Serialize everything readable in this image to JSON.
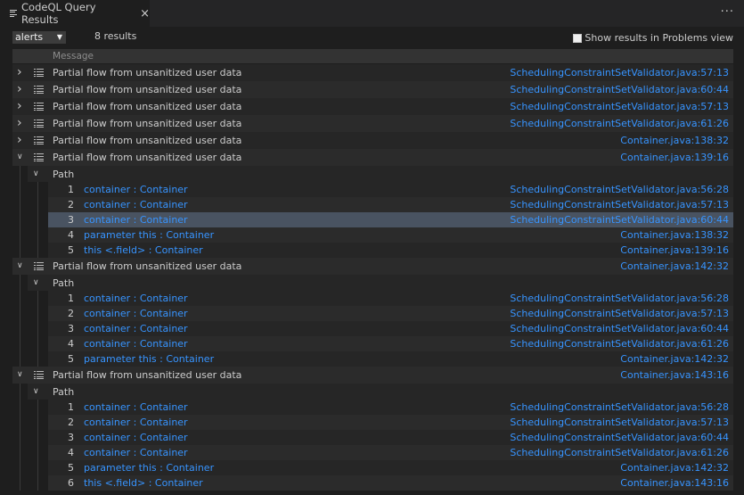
{
  "tab": {
    "title": "CodeQL Query Results",
    "close": "×",
    "icon": "list-icon"
  },
  "more": "···",
  "toolbar": {
    "select_value": "alerts",
    "count": "8 results",
    "problems_label": "Show results in Problems view"
  },
  "header": {
    "message": "Message"
  },
  "results": [
    {
      "message": "Partial flow from unsanitized user data",
      "location": "SchedulingConstraintSetValidator.java:57:13",
      "expanded": false
    },
    {
      "message": "Partial flow from unsanitized user data",
      "location": "SchedulingConstraintSetValidator.java:60:44",
      "expanded": false
    },
    {
      "message": "Partial flow from unsanitized user data",
      "location": "SchedulingConstraintSetValidator.java:57:13",
      "expanded": false
    },
    {
      "message": "Partial flow from unsanitized user data",
      "location": "SchedulingConstraintSetValidator.java:61:26",
      "expanded": false
    },
    {
      "message": "Partial flow from unsanitized user data",
      "location": "Container.java:138:32",
      "expanded": false
    },
    {
      "message": "Partial flow from unsanitized user data",
      "location": "Container.java:139:16",
      "expanded": true,
      "path_label": "Path",
      "steps": [
        {
          "num": "1",
          "text": "container : Container",
          "location": "SchedulingConstraintSetValidator.java:56:28"
        },
        {
          "num": "2",
          "text": "container : Container",
          "location": "SchedulingConstraintSetValidator.java:57:13"
        },
        {
          "num": "3",
          "text": "container : Container",
          "location": "SchedulingConstraintSetValidator.java:60:44",
          "selected": true
        },
        {
          "num": "4",
          "text": "parameter this : Container",
          "location": "Container.java:138:32"
        },
        {
          "num": "5",
          "text": "this <.field> : Container",
          "location": "Container.java:139:16"
        }
      ]
    },
    {
      "message": "Partial flow from unsanitized user data",
      "location": "Container.java:142:32",
      "expanded": true,
      "path_label": "Path",
      "steps": [
        {
          "num": "1",
          "text": "container : Container",
          "location": "SchedulingConstraintSetValidator.java:56:28"
        },
        {
          "num": "2",
          "text": "container : Container",
          "location": "SchedulingConstraintSetValidator.java:57:13"
        },
        {
          "num": "3",
          "text": "container : Container",
          "location": "SchedulingConstraintSetValidator.java:60:44"
        },
        {
          "num": "4",
          "text": "container : Container",
          "location": "SchedulingConstraintSetValidator.java:61:26"
        },
        {
          "num": "5",
          "text": "parameter this : Container",
          "location": "Container.java:142:32"
        }
      ]
    },
    {
      "message": "Partial flow from unsanitized user data",
      "location": "Container.java:143:16",
      "expanded": true,
      "path_label": "Path",
      "steps": [
        {
          "num": "1",
          "text": "container : Container",
          "location": "SchedulingConstraintSetValidator.java:56:28"
        },
        {
          "num": "2",
          "text": "container : Container",
          "location": "SchedulingConstraintSetValidator.java:57:13"
        },
        {
          "num": "3",
          "text": "container : Container",
          "location": "SchedulingConstraintSetValidator.java:60:44"
        },
        {
          "num": "4",
          "text": "container : Container",
          "location": "SchedulingConstraintSetValidator.java:61:26"
        },
        {
          "num": "5",
          "text": "parameter this : Container",
          "location": "Container.java:142:32"
        },
        {
          "num": "6",
          "text": "this <.field> : Container",
          "location": "Container.java:143:16"
        }
      ]
    }
  ]
}
